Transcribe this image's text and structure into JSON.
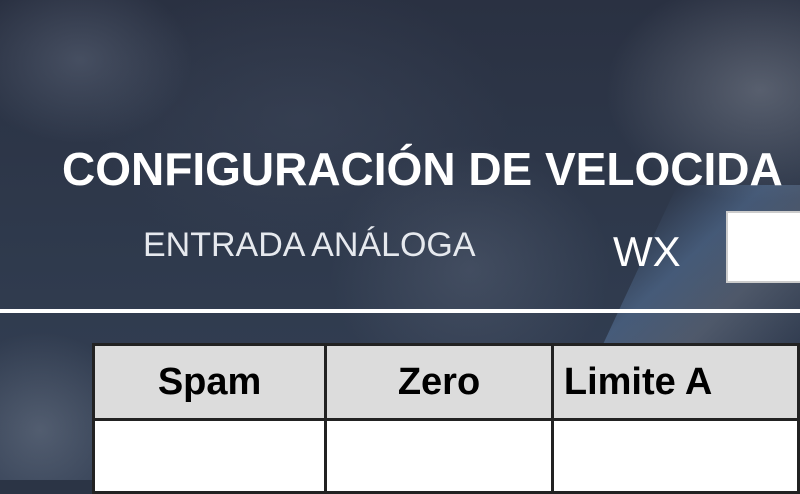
{
  "header": {
    "title": "CONFIGURACIÓN DE VELOCIDA",
    "subtitle": "ENTRADA ANÁLOGA",
    "wx_label": "WX"
  },
  "table": {
    "columns": [
      "Spam",
      "Zero",
      "Limite A"
    ]
  }
}
